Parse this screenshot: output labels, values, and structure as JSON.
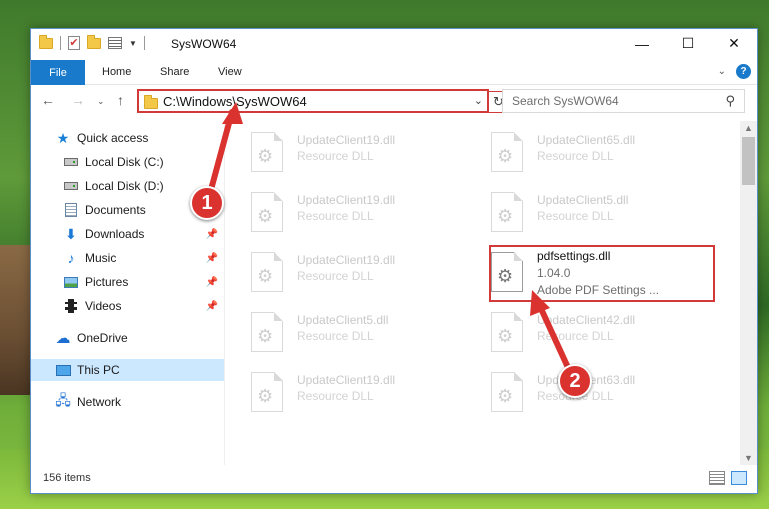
{
  "window": {
    "title": "SysWOW64"
  },
  "titlebar": {
    "minimize": "—",
    "maximize": "☐",
    "close": "✕"
  },
  "ribbon": {
    "tabs": [
      "File",
      "Home",
      "Share",
      "View"
    ],
    "help": "?"
  },
  "address": {
    "path": "C:\\Windows\\SysWOW64",
    "search_placeholder": "Search SysWOW64"
  },
  "nav_pane": {
    "items": [
      {
        "label": "Quick access",
        "icon": "star-icon"
      },
      {
        "label": "Local Disk (C:)",
        "icon": "drive-icon"
      },
      {
        "label": "Local Disk (D:)",
        "icon": "drive-icon"
      },
      {
        "label": "Documents",
        "icon": "documents-icon"
      },
      {
        "label": "Downloads",
        "icon": "download-icon",
        "pinned": true
      },
      {
        "label": "Music",
        "icon": "music-icon",
        "pinned": true
      },
      {
        "label": "Pictures",
        "icon": "pictures-icon",
        "pinned": true
      },
      {
        "label": "Videos",
        "icon": "videos-icon",
        "pinned": true
      },
      {
        "label": "OneDrive",
        "icon": "onedrive-icon"
      },
      {
        "label": "This PC",
        "icon": "pc-icon",
        "selected": true
      },
      {
        "label": "Network",
        "icon": "network-icon"
      }
    ]
  },
  "files": [
    {
      "name": "UpdateClient19.dll",
      "type": "Resource DLL"
    },
    {
      "name": "UpdateClient65.dll",
      "type": "Resource DLL"
    },
    {
      "name": "UpdateClient19.dll",
      "type": "Resource DLL"
    },
    {
      "name": "UpdateClient5.dll",
      "type": "Resource DLL"
    },
    {
      "name": "UpdateClient19.dll",
      "type": "Resource DLL"
    },
    {
      "name": "pdfsettings.dll",
      "version": "1.04.0",
      "type": "Adobe PDF Settings ...",
      "highlighted": true
    },
    {
      "name": "UpdateClient5.dll",
      "type": "Resource DLL"
    },
    {
      "name": "UpdateClient42.dll",
      "type": "Resource DLL"
    },
    {
      "name": "UpdateClient19.dll",
      "type": "Resource DLL"
    },
    {
      "name": "UpdateClient63.dll",
      "type": "Resource DLL"
    }
  ],
  "status": {
    "item_count": "156 items"
  },
  "callouts": [
    "1",
    "2"
  ],
  "colors": {
    "accent": "#1979ca",
    "highlight_red": "#d23a3a",
    "selection": "#cce8ff"
  }
}
